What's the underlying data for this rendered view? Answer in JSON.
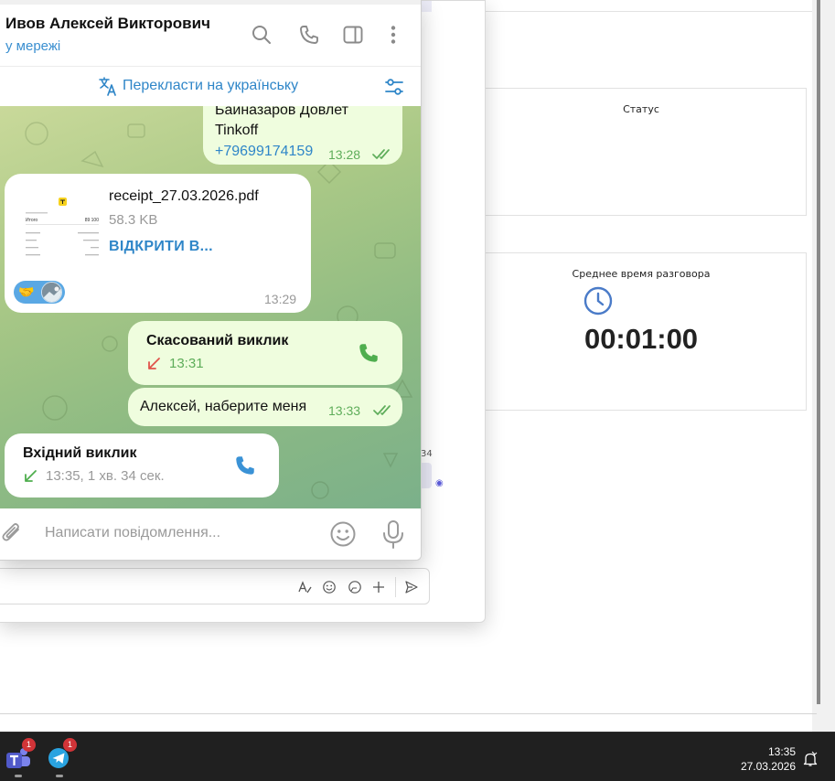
{
  "dashboard": {
    "status_card": {
      "title": "Статус"
    },
    "avg_time_card": {
      "title": "Среднее время разговора",
      "value": "00:01:00"
    },
    "peek_number": "34"
  },
  "telegram": {
    "contact_name": "Ивов Алексей Викторович",
    "contact_status": "у мережі",
    "header_icons": [
      "search-icon",
      "phone-icon",
      "sidebar-panel-icon",
      "more-vertical-icon"
    ],
    "translate_bar": {
      "label": "Перекласти на українську"
    },
    "messages": {
      "previous": {
        "line1": "Байназаров Довлет",
        "line2": "Tinkoff",
        "phone": "+79699174159",
        "time": "13:28"
      },
      "file": {
        "name": "receipt_27.03.2026.pdf",
        "size": "58.3 KB",
        "action": "ВІДКРИТИ В...",
        "time": "13:29",
        "reaction_emoji": "🤝",
        "thumb": {
          "total_label": "Итого",
          "total_value": "89 100"
        }
      },
      "outgoing_call": {
        "title": "Скасований виклик",
        "time": "13:31"
      },
      "text": {
        "body": "Алексей, наберите меня",
        "time": "13:33"
      },
      "incoming_call": {
        "title": "Вхідний виклик",
        "detail": "13:35, 1 хв. 34 сек."
      }
    },
    "composer": {
      "placeholder": "Написати повідомлення..."
    }
  },
  "taskbar": {
    "apps": [
      {
        "name": "Teams",
        "badge": "1"
      },
      {
        "name": "Telegram",
        "badge": "1"
      }
    ],
    "clock": {
      "time": "13:35",
      "date": "27.03.2026"
    }
  },
  "colors": {
    "accent_blue": "#2f86c8",
    "outgoing_bubble": "#effdde",
    "read_green": "#5ead5a",
    "missed_red": "#e0534a",
    "taskbar": "#202020"
  }
}
